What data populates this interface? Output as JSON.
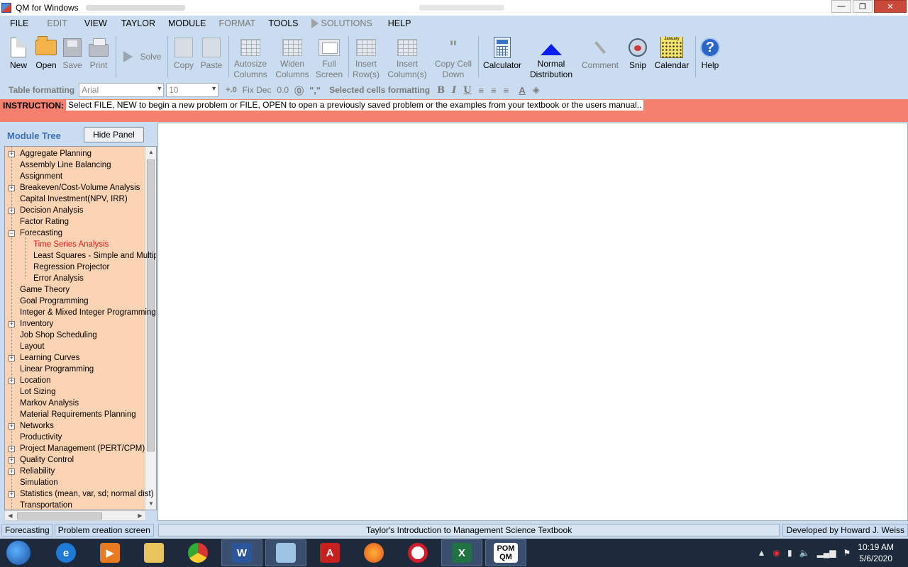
{
  "window": {
    "title": "QM for Windows"
  },
  "menu": [
    "FILE",
    "EDIT",
    "VIEW",
    "TAYLOR",
    "MODULE",
    "FORMAT",
    "TOOLS",
    "SOLUTIONS",
    "HELP"
  ],
  "toolbar": {
    "new": "New",
    "open": "Open",
    "save": "Save",
    "print": "Print",
    "solve": "Solve",
    "copy": "Copy",
    "paste": "Paste",
    "autosize_1": "Autosize",
    "autosize_2": "Columns",
    "widen_1": "Widen",
    "widen_2": "Columns",
    "full_1": "Full",
    "full_2": "Screen",
    "insrow_1": "Insert",
    "insrow_2": "Row(s)",
    "inscol_1": "Insert",
    "inscol_2": "Column(s)",
    "copycell_1": "Copy Cell",
    "copycell_2": "Down",
    "calculator": "Calculator",
    "normal_1": "Normal",
    "normal_2": "Distribution",
    "comment": "Comment",
    "snip": "Snip",
    "calendar": "Calendar",
    "help": "Help"
  },
  "format_bar": {
    "table_formatting": "Table formatting",
    "font": "Arial",
    "size": "10",
    "fixdec": "Fix Dec",
    "dec_value": "0.0",
    "selected_cells": "Selected cells formatting",
    "bold": "B",
    "italic": "I",
    "underline": "U"
  },
  "instruction": {
    "label": "INSTRUCTION:",
    "text": "Select FILE, NEW to begin a new problem or FILE, OPEN to open a previously saved problem or the examples from your textbook or the users manual.."
  },
  "panel": {
    "title": "Module Tree",
    "hide_button": "Hide Panel",
    "items": [
      {
        "label": "Aggregate Planning",
        "expander": "+"
      },
      {
        "label": "Assembly Line Balancing",
        "expander": ""
      },
      {
        "label": "Assignment",
        "expander": ""
      },
      {
        "label": "Breakeven/Cost-Volume Analysis",
        "expander": "+"
      },
      {
        "label": "Capital Investment(NPV, IRR)",
        "expander": ""
      },
      {
        "label": "Decision Analysis",
        "expander": "+"
      },
      {
        "label": "Factor Rating",
        "expander": ""
      },
      {
        "label": "Forecasting",
        "expander": "−"
      },
      {
        "label": "Time Series Analysis",
        "child": true,
        "selected": true
      },
      {
        "label": "Least Squares - Simple and Multip",
        "child": true
      },
      {
        "label": "Regression Projector",
        "child": true
      },
      {
        "label": "Error Analysis",
        "child": true
      },
      {
        "label": "Game Theory",
        "expander": ""
      },
      {
        "label": "Goal Programming",
        "expander": ""
      },
      {
        "label": "Integer & Mixed Integer Programming",
        "expander": ""
      },
      {
        "label": "Inventory",
        "expander": "+"
      },
      {
        "label": "Job Shop Scheduling",
        "expander": ""
      },
      {
        "label": "Layout",
        "expander": ""
      },
      {
        "label": "Learning Curves",
        "expander": "+"
      },
      {
        "label": "Linear Programming",
        "expander": ""
      },
      {
        "label": "Location",
        "expander": "+"
      },
      {
        "label": "Lot Sizing",
        "expander": ""
      },
      {
        "label": "Markov Analysis",
        "expander": ""
      },
      {
        "label": "Material Requirements Planning",
        "expander": ""
      },
      {
        "label": "Networks",
        "expander": "+"
      },
      {
        "label": "Productivity",
        "expander": ""
      },
      {
        "label": "Project Management (PERT/CPM)",
        "expander": "+"
      },
      {
        "label": "Quality Control",
        "expander": "+"
      },
      {
        "label": "Reliability",
        "expander": "+"
      },
      {
        "label": "Simulation",
        "expander": ""
      },
      {
        "label": "Statistics (mean, var, sd; normal dist)",
        "expander": "+"
      },
      {
        "label": "Transportation",
        "expander": ""
      }
    ]
  },
  "status": {
    "module": "Forecasting",
    "screen": "Problem creation screen",
    "textbook": "Taylor's Introduction to Management Science Textbook",
    "author": "Developed by Howard J. Weiss"
  },
  "taskbar": {
    "time": "10:19 AM",
    "date": "5/6/2020",
    "pom_1": "POM",
    "pom_2": "QM"
  },
  "colors": {
    "chrome": "#c9dcf0",
    "instruction_bg": "#f5806d",
    "tree_bg": "#fcd3b3",
    "selected_item": "#e02020",
    "panel_title": "#3a6fb4"
  }
}
